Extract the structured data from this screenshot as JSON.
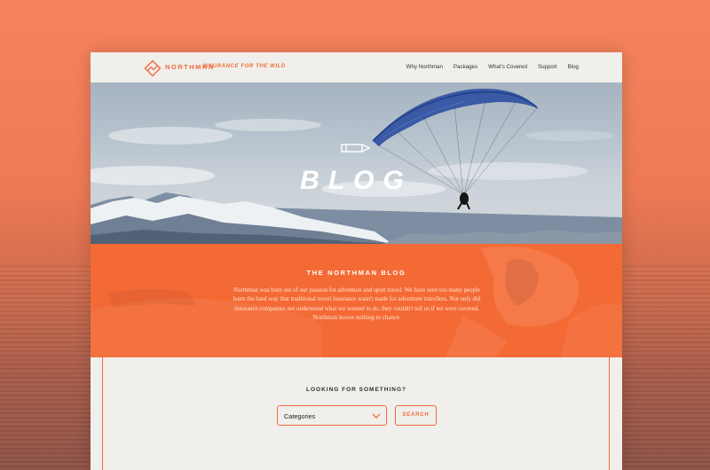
{
  "header": {
    "brand": "NORTHMAN",
    "tagline": "INSURANCE FOR THE WILD",
    "nav": [
      "Why Northman",
      "Packages",
      "What's Covered",
      "Support",
      "Blog"
    ]
  },
  "hero": {
    "title": "BLOG",
    "icon": "pencil-icon"
  },
  "intro": {
    "title": "THE NORTHMAN BLOG",
    "body": "Northman was born out of our passion for adventure and sport travel. We have seen too many people learn the hard way that traditional travel insurance wasn't made for adventure travellers. Not only did insurance companies not understand what we wanted to do, they couldn't tell us if we were covered. Northman leaves nothing to chance."
  },
  "search": {
    "heading": "LOOKING FOR SOMETHING?",
    "select_value": "Categories",
    "button_label": "SEARCH"
  },
  "colors": {
    "accent": "#f26b3a",
    "background": "#f5825d",
    "page": "#f0efec"
  }
}
